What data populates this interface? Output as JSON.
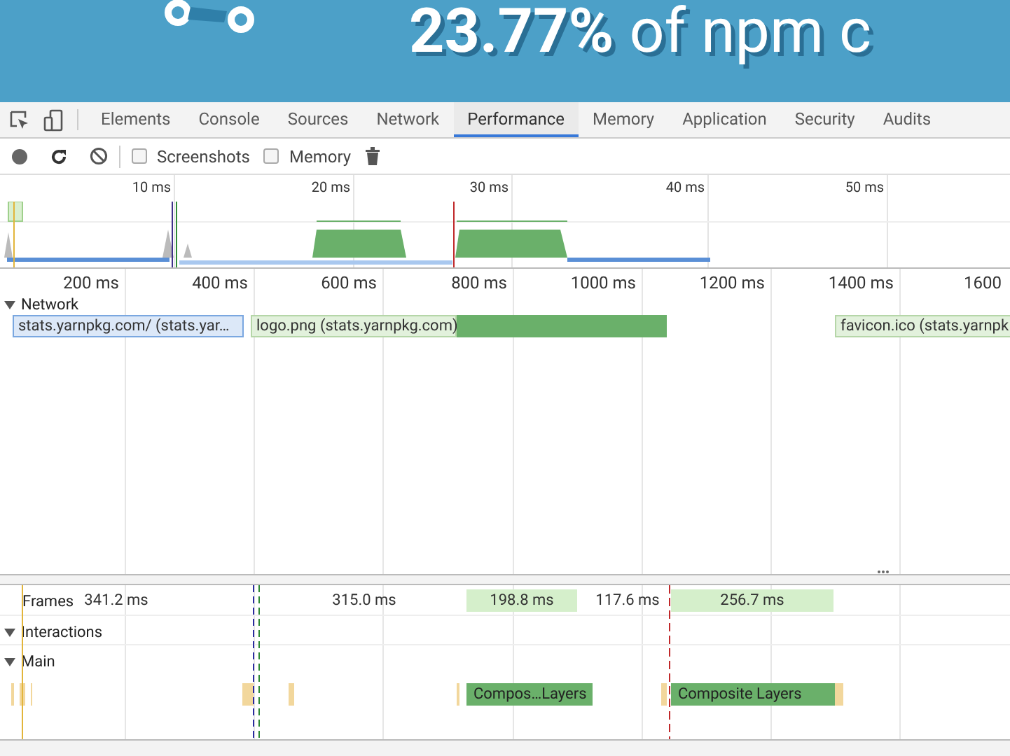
{
  "banner": {
    "headline": "23.77%",
    "text": "of npm c"
  },
  "devtools_tabs": [
    {
      "label": "Elements",
      "selected": false
    },
    {
      "label": "Console",
      "selected": false
    },
    {
      "label": "Sources",
      "selected": false
    },
    {
      "label": "Network",
      "selected": false
    },
    {
      "label": "Performance",
      "selected": true
    },
    {
      "label": "Memory",
      "selected": false
    },
    {
      "label": "Application",
      "selected": false
    },
    {
      "label": "Security",
      "selected": false
    },
    {
      "label": "Audits",
      "selected": false
    }
  ],
  "toolbar": {
    "checkboxes": [
      {
        "label": "Screenshots",
        "checked": false
      },
      {
        "label": "Memory",
        "checked": false
      }
    ]
  },
  "overview": {
    "ticks": [
      "10 ms",
      "20 ms",
      "30 ms",
      "40 ms",
      "50 ms"
    ]
  },
  "ruler": {
    "ticks": [
      "200 ms",
      "400 ms",
      "600 ms",
      "800 ms",
      "1000 ms",
      "1200 ms",
      "1400 ms",
      "1600"
    ]
  },
  "network": {
    "title": "Network",
    "expanded": true,
    "requests": [
      {
        "label": "stats.yarnpkg.com/ (stats.yar…"
      },
      {
        "label": "logo.png (stats.yarnpkg.com)"
      },
      {
        "label": "favicon.ico (stats.yarnpk"
      }
    ]
  },
  "frames": {
    "title": "Frames",
    "durations": [
      {
        "label": "341.2 ms",
        "highlighted": false
      },
      {
        "label": "315.0 ms",
        "highlighted": false
      },
      {
        "label": "198.8 ms",
        "highlighted": true
      },
      {
        "label": "117.6 ms",
        "highlighted": false
      },
      {
        "label": "256.7 ms",
        "highlighted": true
      }
    ]
  },
  "interactions": {
    "title": "Interactions",
    "expanded": true
  },
  "main": {
    "title": "Main",
    "expanded": true,
    "tasks": [
      {
        "label": "Compos…Layers"
      },
      {
        "label": "Composite Layers"
      }
    ]
  }
}
